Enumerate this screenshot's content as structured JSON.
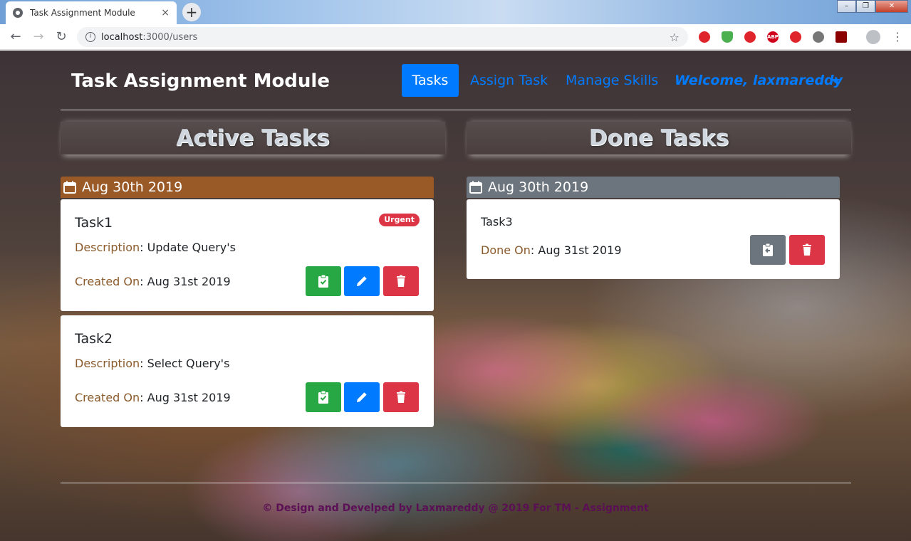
{
  "browser": {
    "tab_title": "Task Assignment Module",
    "tab_close": "×",
    "new_tab": "+",
    "url_host": "localhost",
    "url_path": ":3000/users",
    "window_controls": [
      "–",
      "❐",
      "✕"
    ]
  },
  "navbar": {
    "brand": "Task Assignment Module",
    "items": [
      {
        "label": "Tasks",
        "active": true
      },
      {
        "label": "Assign Task",
        "active": false
      },
      {
        "label": "Manage Skills",
        "active": false
      }
    ],
    "welcome": "Welcome, laxmareddy"
  },
  "active": {
    "heading": "Active Tasks",
    "date": "Aug 30th 2019",
    "date_bar_color": "#9a5a28",
    "tasks": [
      {
        "title": "Task1",
        "badge": "Urgent",
        "description_label": "Description",
        "description": ": Update Query's",
        "created_label": "Created On",
        "created": ": Aug 31st 2019"
      },
      {
        "title": "Task2",
        "description_label": "Description",
        "description": ": Select Query's",
        "created_label": "Created On",
        "created": ": Aug 31st 2019"
      }
    ]
  },
  "done": {
    "heading": "Done Tasks",
    "date": "Aug 30th 2019",
    "date_bar_color": "#6c757d",
    "tasks": [
      {
        "title": "Task3",
        "done_label": "Done On",
        "done": ": Aug 31st 2019"
      }
    ]
  },
  "footer": "© Design and Develped by Laxmareddy @ 2019 For TM - Assignment",
  "colors": {
    "primary": "#007bff",
    "success": "#28a745",
    "danger": "#dc3545",
    "secondary": "#6c757d",
    "label": "#8a5a2b",
    "footer": "#5b0f55"
  },
  "icons": {
    "complete": "clipboard-check-icon",
    "edit": "pencil-icon",
    "delete": "trash-icon",
    "undo": "clipboard-return-icon",
    "calendar": "calendar-icon"
  }
}
